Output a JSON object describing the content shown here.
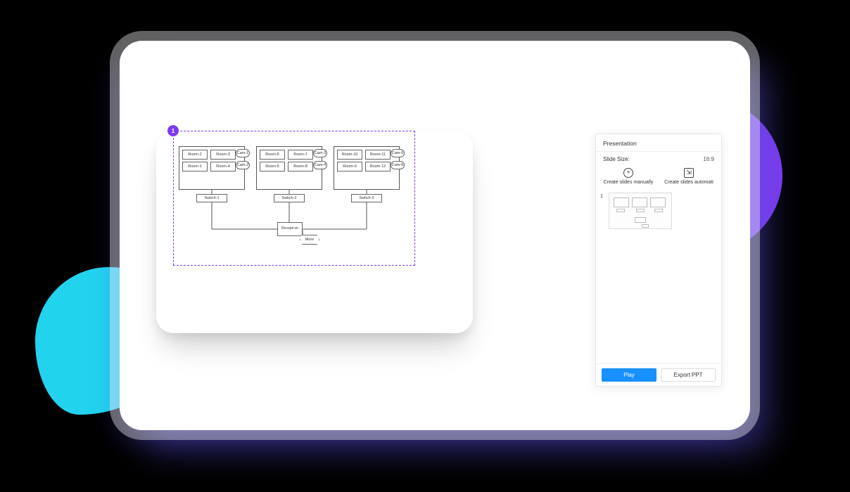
{
  "frame_badge": "1",
  "diagram": {
    "clusters": [
      {
        "rooms": [
          "Room-2",
          "Room-3",
          "Room-1",
          "Room-4"
        ],
        "cams": [
          "Cam-1",
          "Cam-2"
        ],
        "switch": "Switch-1"
      },
      {
        "rooms": [
          "Room-6",
          "Room-7",
          "Room-5",
          "Room-8"
        ],
        "cams": [
          "Cam-3",
          "Cam-4"
        ],
        "switch": "Switch-2"
      },
      {
        "rooms": [
          "Room-10",
          "Room-11",
          "Room-9",
          "Room-12"
        ],
        "cams": [
          "Cam-5",
          "Cam-6"
        ],
        "switch": "Switch-3"
      }
    ],
    "reception": "Recepti\non",
    "more": "More"
  },
  "panel": {
    "title": "Presentation",
    "size_label": "Slide Size:",
    "size_value": "16:9",
    "create_manual": "Create slides manually",
    "create_auto": "Create slides automati",
    "plus_glyph": "+",
    "auto_glyph": "⇲",
    "thumb_num": "1",
    "play": "Play",
    "export": "Export PPT"
  }
}
